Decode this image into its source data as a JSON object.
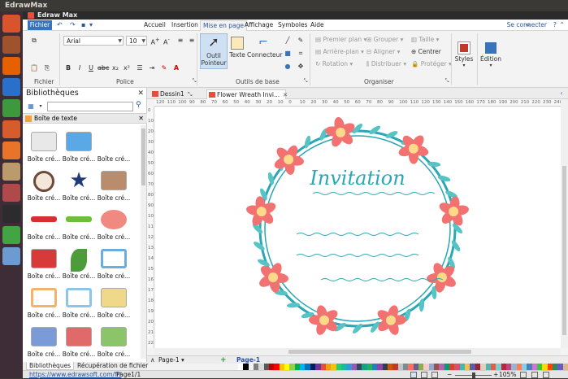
{
  "os": {
    "title": "EdrawMax",
    "launcher": [
      {
        "name": "ubuntu-icon",
        "color": "#d9532b"
      },
      {
        "name": "files-icon",
        "color": "#a0522d"
      },
      {
        "name": "firefox-icon",
        "color": "#e66000"
      },
      {
        "name": "writer-icon",
        "color": "#2a6fc9"
      },
      {
        "name": "calc-icon",
        "color": "#3c9a3c"
      },
      {
        "name": "impress-icon",
        "color": "#d65c2b"
      },
      {
        "name": "software-center-icon",
        "color": "#e8742a"
      },
      {
        "name": "amazon-icon",
        "color": "#bb9b6d"
      },
      {
        "name": "settings-icon",
        "color": "#b04a4a"
      },
      {
        "name": "terminal-icon",
        "color": "#2c2c2c"
      },
      {
        "name": "qt-icon",
        "color": "#41a541"
      },
      {
        "name": "edraw-icon",
        "color": "#6b9bd1"
      }
    ]
  },
  "app": {
    "title": "Edraw Max",
    "accent": "#3973ba",
    "file_menu": "Fichier",
    "tabs": [
      "Accueil",
      "Insertion",
      "Mise en page",
      "Affichage",
      "Symboles",
      "Aide"
    ],
    "active_tab": "Mise en page",
    "signin": "Se connecter"
  },
  "ribbon": {
    "font_name": "Arial",
    "font_size": "10",
    "groups": {
      "file": "Fichier",
      "font": "Police",
      "basic_tools": "Outils de base",
      "arrange": "Organiser"
    },
    "tools": {
      "select": "Outil",
      "select2": "Pointeur",
      "text": "Texte",
      "connector": "Connecteur"
    },
    "arrange": {
      "front": "Premier plan",
      "back": "Arrière-plan",
      "rotate": "Rotation",
      "group": "Grouper",
      "align": "Aligner",
      "distribute": "Distribuer",
      "size": "Taille",
      "center": "Centrer",
      "protect": "Protéger"
    },
    "styles": "Styles",
    "edition": "Édition"
  },
  "library": {
    "title": "Bibliothèques",
    "search_placeholder": "",
    "category": "Boîte de texte",
    "shape_label": "Boîte cré...",
    "shapes": [
      {
        "name": "gradient-textbox",
        "color": "#e8e8e8"
      },
      {
        "name": "blue-textbox",
        "color": "#5aa9e6"
      },
      {
        "name": "hanging-frame",
        "color": "#ffffff"
      },
      {
        "name": "circle-frame",
        "color": "#f4e6d8"
      },
      {
        "name": "star-badge",
        "color": "#203a7a"
      },
      {
        "name": "tag-label",
        "color": "#b98c6e"
      },
      {
        "name": "red-ribbon",
        "color": "#d62f2f"
      },
      {
        "name": "green-bar",
        "color": "#6cbf3a"
      },
      {
        "name": "speech-bubble",
        "color": "#f08a80"
      },
      {
        "name": "red-flag",
        "color": "#d83a3a"
      },
      {
        "name": "green-leaf",
        "color": "#4c9c3a"
      },
      {
        "name": "blue-square-frame",
        "color": "#6aaee0"
      },
      {
        "name": "orange-frame",
        "color": "#f2b36b"
      },
      {
        "name": "blue-frame",
        "color": "#8cc4ea"
      },
      {
        "name": "scroll-banner",
        "color": "#f0d88a"
      },
      {
        "name": "blue-rounded-box",
        "color": "#7a9ad8"
      },
      {
        "name": "red-header-box",
        "color": "#e06a6a"
      },
      {
        "name": "green-header-box",
        "color": "#8cc46a"
      }
    ]
  },
  "documents": {
    "tabs": [
      "Dessin1",
      "Flower Wreath Invi..."
    ],
    "active": 1
  },
  "canvas": {
    "heading": "Invitation",
    "heading_color": "#2aa6b4",
    "wreath_color": "#2aa6b4",
    "flower_color": "#f27272",
    "flower_center": "#ffd98a",
    "leaf_color": "#56c4c4"
  },
  "ruler": {
    "h": [
      "120",
      "110",
      "100",
      "90",
      "80",
      "70",
      "60",
      "50",
      "40",
      "30",
      "20",
      "10",
      "0",
      "10",
      "20",
      "30",
      "40",
      "50",
      "60",
      "70",
      "80",
      "90",
      "100",
      "110",
      "120",
      "130",
      "140",
      "150",
      "160",
      "170",
      "180",
      "190",
      "200",
      "210",
      "220",
      "230",
      "240",
      "250"
    ],
    "v": [
      "0",
      "10",
      "20",
      "30",
      "40",
      "50",
      "60",
      "70",
      "80",
      "90",
      "100",
      "110",
      "120",
      "130",
      "140",
      "150",
      "160",
      "170",
      "180",
      "190",
      "200",
      "210",
      "220"
    ]
  },
  "pages": {
    "current": "Page-1",
    "tab": "Page-1",
    "add": "+"
  },
  "bottom_tabs": [
    "Bibliothèques",
    "Récupération de fichier"
  ],
  "status": {
    "link": "https://www.edrawsoft.com/fr/",
    "page": "Page1/1",
    "zoom": "105%",
    "zoom_fraction": 0.5
  },
  "palette": [
    "#ffffff",
    "#000000",
    "#f2f2f2",
    "#7f7f7f",
    "#d9d9d9",
    "#595959",
    "#c00000",
    "#ff0000",
    "#ffc000",
    "#ffff00",
    "#92d050",
    "#00b050",
    "#00b0f0",
    "#0070c0",
    "#002060",
    "#7030a0",
    "#e74c3c",
    "#f39c12",
    "#f1c40f",
    "#2ecc71",
    "#1abc9c",
    "#3498db",
    "#9b59b6",
    "#34495e",
    "#16a085",
    "#27ae60",
    "#2980b9",
    "#8e44ad",
    "#2c3e50",
    "#d35400",
    "#c0392b",
    "#bdc3c7",
    "#7f8c8d",
    "#ff6f61",
    "#6b5b95",
    "#88b04b",
    "#f7cac9",
    "#92a8d1",
    "#955251",
    "#b565a7",
    "#009b77",
    "#dd4124",
    "#d65076",
    "#45b8ac",
    "#efc050",
    "#5b5ea6",
    "#9b2335",
    "#dfcfbe",
    "#55b4b0",
    "#e15d44",
    "#7fcdcd",
    "#bc243c",
    "#c3447a",
    "#98b4d4",
    "#ff7f50",
    "#87ceeb",
    "#4682b4",
    "#da70d6",
    "#32cd32",
    "#ffd700",
    "#ff4500",
    "#2e8b57",
    "#6a5acd",
    "#deb887"
  ]
}
